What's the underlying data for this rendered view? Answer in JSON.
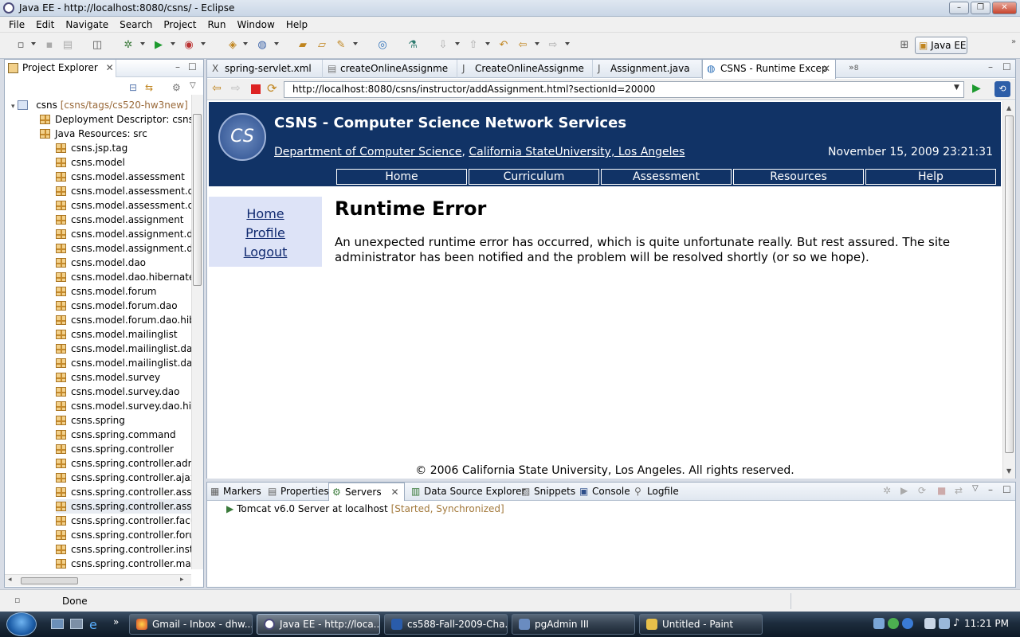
{
  "window": {
    "title": "Java EE - http://localhost:8080/csns/ - Eclipse"
  },
  "menu": [
    "File",
    "Edit",
    "Navigate",
    "Search",
    "Project",
    "Run",
    "Window",
    "Help"
  ],
  "perspective": {
    "label": "Java EE"
  },
  "project_explorer": {
    "title": "Project Explorer",
    "project": {
      "name": "csns",
      "decoration": "[csns/tags/cs520-hw3new]"
    },
    "items": [
      "Deployment Descriptor: csns",
      "Java Resources: src",
      "csns.jsp.tag",
      "csns.model",
      "csns.model.assessment",
      "csns.model.assessment.dao",
      "csns.model.assessment.dao",
      "csns.model.assignment",
      "csns.model.assignment.dao",
      "csns.model.assignment.dao",
      "csns.model.dao",
      "csns.model.dao.hibernate",
      "csns.model.forum",
      "csns.model.forum.dao",
      "csns.model.forum.dao.hiber",
      "csns.model.mailinglist",
      "csns.model.mailinglist.dao",
      "csns.model.mailinglist.dao.h",
      "csns.model.survey",
      "csns.model.survey.dao",
      "csns.model.survey.dao.hibe",
      "csns.spring",
      "csns.spring.command",
      "csns.spring.controller",
      "csns.spring.controller.admir",
      "csns.spring.controller.ajax",
      "csns.spring.controller.assess",
      "csns.spring.controller.assign",
      "csns.spring.controller.facult",
      "csns.spring.controller.forum",
      "csns.spring.controller.instru",
      "csns.spring.controller.mailir"
    ]
  },
  "editor_tabs": [
    "spring-servlet.xml",
    "createOnlineAssignme",
    "CreateOnlineAssignme",
    "Assignment.java",
    "CSNS - Runtime Excep"
  ],
  "editor_overflow": "8",
  "browser": {
    "url": "http://localhost:8080/csns/instructor/addAssignment.html?sectionId=20000"
  },
  "site": {
    "logo_text": "CS",
    "title": "CSNS - Computer Science Network Services",
    "dept_link": "Department of Computer Science",
    "separator": ",",
    "univ_link": "California StateUniversity, Los Angeles",
    "datetime": "November 15, 2009 23:21:31",
    "nav": [
      "Home",
      "Curriculum",
      "Assessment",
      "Resources",
      "Help"
    ],
    "side": [
      "Home",
      "Profile",
      "Logout"
    ],
    "error_title": "Runtime Error",
    "error_message": "An unexpected runtime error has occurred, which is quite unfortunate really. But rest assured. The site administrator has been notified and the problem will be resolved shortly (or so we hope).",
    "footer": "© 2006 California State University, Los Angeles. All rights reserved."
  },
  "bottom_tabs": [
    "Markers",
    "Properties",
    "Servers",
    "Data Source Explorer",
    "Snippets",
    "Console",
    "Logfile"
  ],
  "servers": [
    {
      "name": "Tomcat v6.0 Server at localhost",
      "status": "[Started, Synchronized]"
    }
  ],
  "status": {
    "text": "Done"
  },
  "taskbar": {
    "tasks": [
      "Gmail - Inbox - dhw...",
      "Java EE - http://loca...",
      "cs588-Fall-2009-Cha...",
      "pgAdmin III",
      "Untitled - Paint"
    ],
    "clock": "11:21 PM"
  }
}
